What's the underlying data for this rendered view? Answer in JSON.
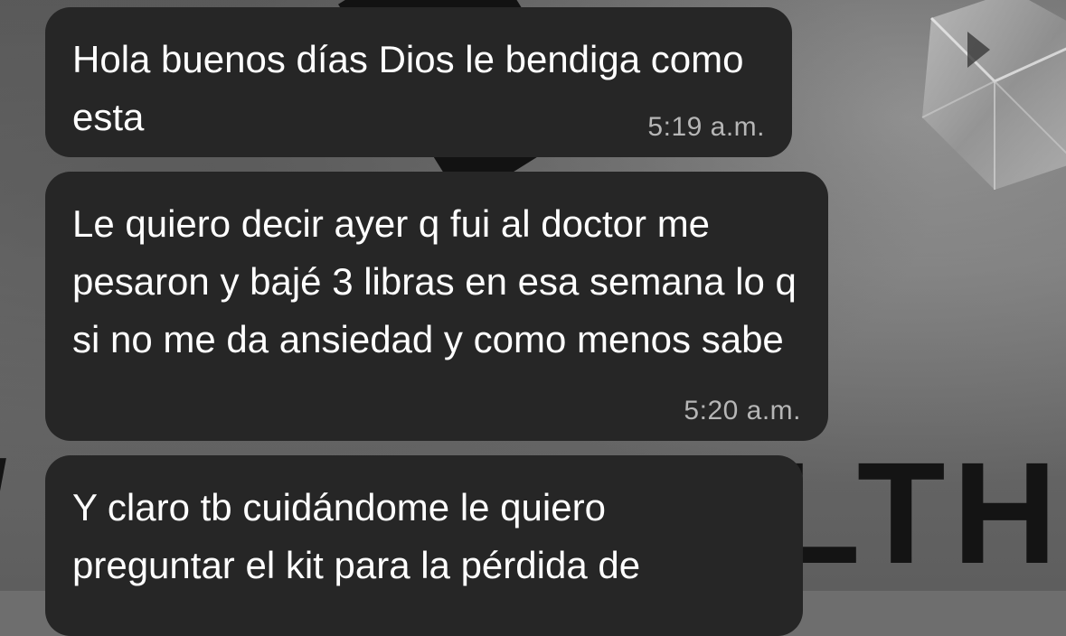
{
  "messages": [
    {
      "text": "Hola buenos días Dios le bendiga como esta",
      "time": "5:19 a.m."
    },
    {
      "text": "Le quiero decir ayer q fui al doctor me pesaron y bajé 3 libras en esa semana lo q si no me da ansiedad y como menos sabe",
      "time": "5:20 a.m."
    },
    {
      "text": "Y claro tb cuidándome le quiero preguntar el kit para la pérdida de",
      "time": ""
    }
  ],
  "wallpaper": {
    "letters_left": "/",
    "letters_right": "LTH",
    "colors": {
      "bubble": "#262626",
      "text": "#ffffff",
      "timestamp": "#b6b6b6"
    }
  }
}
